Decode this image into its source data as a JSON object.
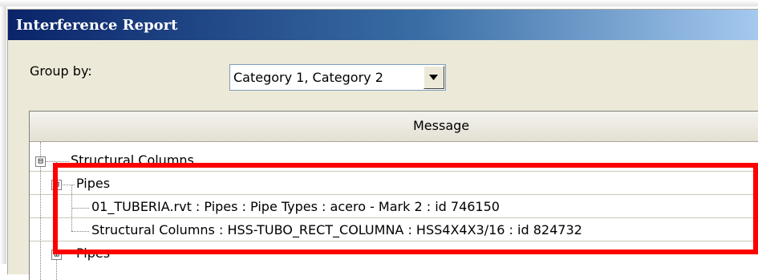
{
  "window": {
    "title": "Interference Report"
  },
  "group_by": {
    "label": "Group by:",
    "value": "Category 1, Category 2"
  },
  "grid": {
    "column_header": "Message",
    "tree": [
      {
        "label": "Structural Columns",
        "expanded": true,
        "toggle": "⊟"
      },
      {
        "label": "Pipes",
        "expanded": true,
        "toggle": "⊟"
      },
      {
        "label": "01_TUBERIA.rvt : Pipes : Pipe Types : acero - Mark 2 : id 746150"
      },
      {
        "label": "Structural Columns : HSS-TUBO_RECT_COLUMNA : HSS4X4X3/16 : id 824732"
      },
      {
        "label": "Pipes",
        "expanded": false,
        "toggle": "⊞"
      }
    ]
  },
  "highlight_color": "#ff0000",
  "accent": {
    "titlebar_start": "#0a246a",
    "titlebar_end": "#a6caf0"
  }
}
